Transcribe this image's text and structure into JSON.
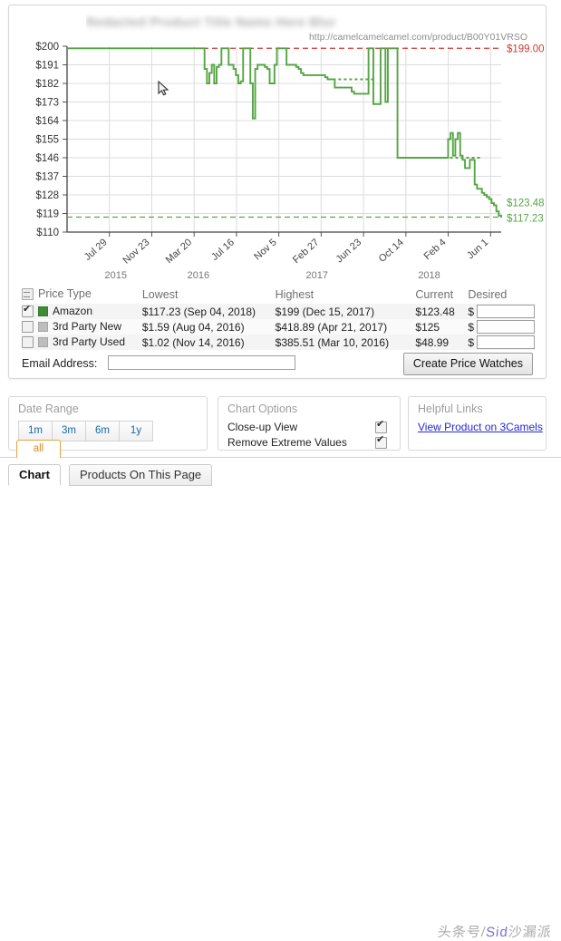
{
  "product": {
    "title_blurred": "Redacted Product Title Name Here Blur",
    "url": "http://camelcamelcamel.com/product/B00Y01VRSO"
  },
  "chart_data": {
    "type": "line",
    "title": "",
    "xlabel": "",
    "ylabel": "",
    "ylim": [
      110,
      200
    ],
    "grid": true,
    "legend_position": "none",
    "ytick_labels": [
      "$200",
      "$191",
      "$182",
      "$173",
      "$164",
      "$155",
      "$146",
      "$137",
      "$128",
      "$119",
      "$110"
    ],
    "ytick_values": [
      200,
      191,
      182,
      173,
      164,
      155,
      146,
      137,
      128,
      119,
      110
    ],
    "xtick_labels": [
      "Jul 29",
      "Nov 23",
      "Mar 20",
      "Jul 16",
      "Nov 5",
      "Feb 27",
      "Jun 23",
      "Oct 14",
      "Feb 4",
      "Jun 1"
    ],
    "year_labels": [
      "2015",
      "2016",
      "2017",
      "2018"
    ],
    "series": [
      {
        "name": "Amazon",
        "color": "#55a544",
        "style": "step",
        "values": [
          199,
          199,
          199,
          199,
          199,
          199,
          199,
          199,
          199,
          199,
          199,
          199,
          199,
          199,
          199,
          199,
          199,
          199,
          199,
          199,
          199,
          199,
          199,
          199,
          199,
          199,
          199,
          199,
          199,
          199,
          199,
          199,
          199,
          199,
          199,
          199,
          199,
          199,
          199,
          199,
          199,
          199,
          199,
          199,
          199,
          199,
          199,
          199,
          199,
          199,
          199,
          199,
          199,
          199,
          199,
          199,
          199,
          189,
          182,
          187,
          191,
          182,
          190,
          191,
          199,
          199,
          199,
          191,
          191,
          189,
          186,
          182,
          183,
          199,
          199,
          199,
          182,
          165,
          189,
          191,
          191,
          191,
          190,
          189,
          182,
          182,
          191,
          199,
          199,
          199,
          199,
          191,
          191,
          191,
          191,
          190,
          189,
          187,
          186,
          186,
          186,
          186,
          186,
          186,
          186,
          186,
          186,
          185,
          184,
          184,
          184,
          180,
          180,
          180,
          180,
          180,
          180,
          180,
          178,
          177,
          177,
          177,
          177,
          177,
          177,
          199,
          199,
          172,
          172,
          172,
          199,
          199,
          173,
          199,
          199,
          199,
          199,
          146,
          146,
          146,
          146,
          146,
          146,
          146,
          146,
          146,
          146,
          146,
          146,
          146,
          146,
          146,
          146,
          146,
          146,
          146,
          146,
          146,
          155,
          158,
          147,
          155,
          158,
          147,
          145,
          141,
          141,
          145,
          145,
          133,
          131,
          131,
          129,
          128,
          127,
          126,
          124,
          123,
          120,
          118,
          117
        ]
      }
    ],
    "reference_lines": [
      {
        "name": "highest",
        "value": 199,
        "label": "$199.00",
        "color": "#cc3b33",
        "style": "dashed"
      },
      {
        "name": "lowest",
        "value": 117.23,
        "label": "$117.23",
        "color": "#55a544",
        "style": "dashed"
      }
    ],
    "annotations": [
      {
        "label": "$199.00",
        "value": 199,
        "color": "#cc3b33"
      },
      {
        "label": "$123.48",
        "value": 123.48,
        "color": "#55a544"
      },
      {
        "label": "$117.23",
        "value": 117.23,
        "color": "#55a544"
      }
    ]
  },
  "price_table": {
    "headers": [
      "Price Type",
      "Lowest",
      "Highest",
      "Current",
      "Desired"
    ],
    "rows": [
      {
        "type": "Amazon",
        "checked": true,
        "swatch": "#3d8b37",
        "lowest": "$117.23 (Sep 04, 2018)",
        "highest": "$199 (Dec 15, 2017)",
        "current": "$123.48",
        "dollar": "$",
        "desired_value": ""
      },
      {
        "type": "3rd Party New",
        "checked": false,
        "swatch": "#bdbdbd",
        "lowest": "$1.59 (Aug 04, 2016)",
        "highest": "$418.89 (Apr 21, 2017)",
        "current": "$125",
        "dollar": "$",
        "desired_value": ""
      },
      {
        "type": "3rd Party Used",
        "checked": false,
        "swatch": "#bdbdbd",
        "lowest": "$1.02 (Nov 14, 2016)",
        "highest": "$385.51 (Mar 10, 2016)",
        "current": "$48.99",
        "dollar": "$",
        "desired_value": ""
      }
    ],
    "email_label": "Email Address:",
    "email_value": "",
    "email_placeholder": "",
    "create_button": "Create Price Watches"
  },
  "date_range": {
    "title": "Date Range",
    "buttons": [
      "1m",
      "3m",
      "6m",
      "1y"
    ],
    "selected_tab": "all"
  },
  "chart_options": {
    "title": "Chart Options",
    "items": [
      {
        "label": "Close-up View",
        "checked": true
      },
      {
        "label": "Remove Extreme Values",
        "checked": true
      }
    ]
  },
  "helpful_links": {
    "title": "Helpful Links",
    "link": "View Product on 3Camels"
  },
  "tabs": [
    {
      "label": "Chart",
      "active": true
    },
    {
      "label": "Products On This Page",
      "active": false
    }
  ],
  "watermark": {
    "prefix": "头条号",
    "sep": "/",
    "accent": "Sid",
    "suffix": "沙漏派"
  }
}
